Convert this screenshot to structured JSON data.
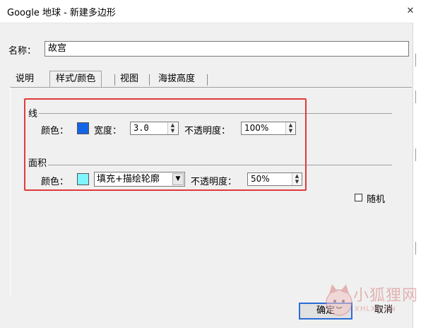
{
  "window": {
    "title": "Google 地球 - 新建多边形",
    "close_glyph": "✕"
  },
  "name_field": {
    "label": "名称：",
    "value": "故宫"
  },
  "tabs": [
    {
      "label": "说明"
    },
    {
      "label": "样式/颜色"
    },
    {
      "label": "视图"
    },
    {
      "label": "海拔高度"
    }
  ],
  "active_tab": "样式/颜色",
  "line_section": {
    "heading": "线",
    "color_label": "颜色：",
    "color": "#1464e6",
    "width_label": "宽度：",
    "width_value": "3.0",
    "opacity_label": "不透明度：",
    "opacity_value": "100%"
  },
  "area_section": {
    "heading": "面积",
    "color_label": "颜色：",
    "color": "#7ff5ff",
    "fill_mode": "填充+描绘轮廓",
    "opacity_label": "不透明度：",
    "opacity_value": "50%"
  },
  "random_checkbox": {
    "label": "随机",
    "checked": false
  },
  "buttons": {
    "ok": "确定",
    "cancel": "取消"
  },
  "icons": {
    "spin": "spin-up-down-icon",
    "dropdown": "chevron-down-icon",
    "close": "close-icon"
  },
  "watermark": {
    "brand_text": "小狐狸网",
    "url_text": "XHLXS.CN"
  },
  "colors": {
    "highlight": "#e03a3a",
    "default_button_border": "#2b6cd8"
  }
}
